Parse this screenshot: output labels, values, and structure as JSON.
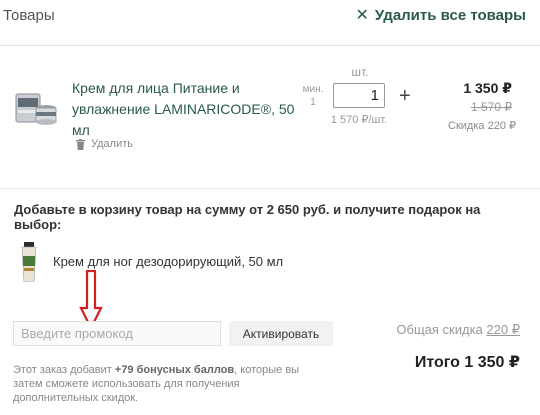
{
  "header": {
    "title": "Товары",
    "clear_all_label": "Удалить все товары",
    "clear_icon": "close-icon"
  },
  "cart_item": {
    "name": "Крем для лица Питание и увлажнение LAMINARICODE®, 50 мл",
    "remove_label": "Удалить",
    "remove_icon": "trash-icon",
    "min_label": "мин.",
    "min_value": "1",
    "qty_unit": "шт.",
    "qty_value": "1",
    "plus_label": "+",
    "unit_price": "1 570 ₽/шт.",
    "price_now": "1 350 ₽",
    "price_old": "1 570 ₽",
    "discount": "Скидка 220 ₽"
  },
  "gift": {
    "offer_text": "Добавьте в корзину товар на сумму от 2 650 руб. и получите подарок на выбор:",
    "item_name": "Крем для ног дезодорирующий, 50 мл"
  },
  "promo": {
    "placeholder": "Введите промокод",
    "button_label": "Активировать"
  },
  "summary": {
    "total_discount_label": "Общая скидка",
    "total_discount_value": "220 ₽",
    "total": "Итого 1 350 ₽"
  },
  "bonus": {
    "text_before": "Этот заказ добавит",
    "points": "+79 бонусных баллов",
    "text_after": ", которые вы затем сможете использовать для получения дополнительных скидок."
  },
  "colors": {
    "accent": "#2a5a46",
    "arrow": "#d11f1f"
  }
}
